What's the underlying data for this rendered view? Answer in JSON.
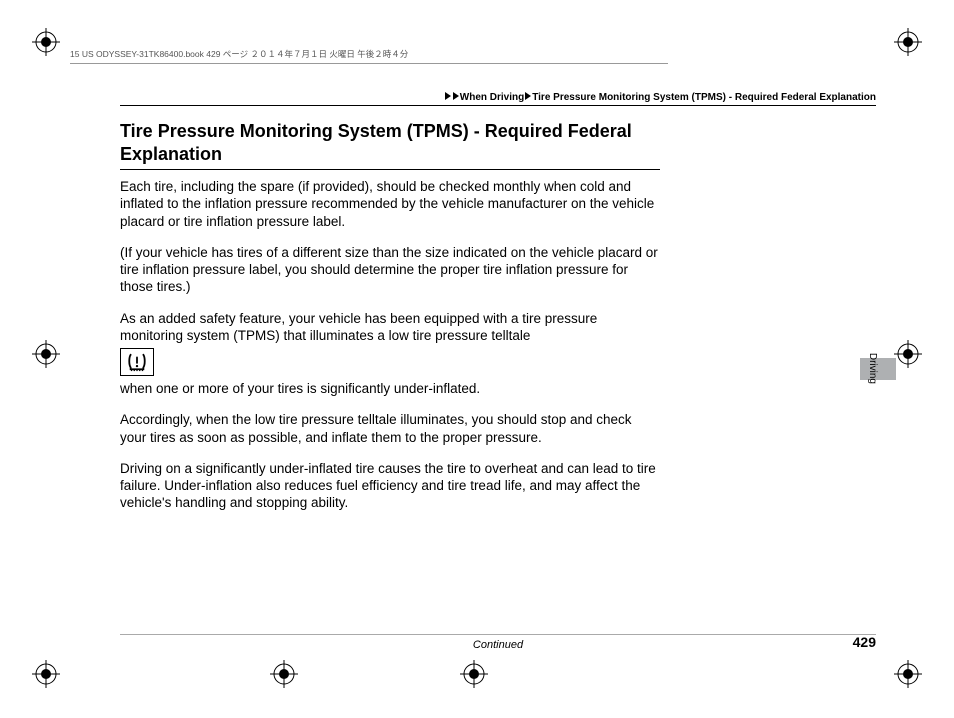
{
  "book_header": "15 US ODYSSEY-31TK86400.book  429 ページ  ２０１４年７月１日  火曜日  午後２時４分",
  "breadcrumb": {
    "section": "When Driving",
    "subsection": "Tire Pressure Monitoring System (TPMS) - Required Federal Explanation"
  },
  "title": "Tire Pressure Monitoring System (TPMS) - Required Federal Explanation",
  "paragraphs": {
    "p1": "Each tire, including the spare (if provided), should be checked monthly when cold and inflated to the inflation pressure recommended by the vehicle manufacturer on the vehicle placard or tire inflation pressure label.",
    "p2": "(If your vehicle has tires of a different size than the size indicated on the vehicle placard or tire inflation pressure label, you should determine the proper tire inflation pressure for those tires.)",
    "p3a": "As an added safety feature, your vehicle has been equipped with a tire pressure monitoring system (TPMS) that illuminates a low tire pressure telltale",
    "p3b": "when one or more of your tires is significantly under-inflated.",
    "p4": "Accordingly, when the low tire pressure telltale illuminates, you should stop and check your tires as soon as possible, and inflate them to the proper pressure.",
    "p5": "Driving on a significantly under-inflated tire causes the tire to overheat and can lead to tire failure. Under-inflation also reduces fuel efficiency and tire tread life, and may affect the vehicle's handling and stopping ability."
  },
  "continued": "Continued",
  "page_number": "429",
  "side_label": "Driving"
}
